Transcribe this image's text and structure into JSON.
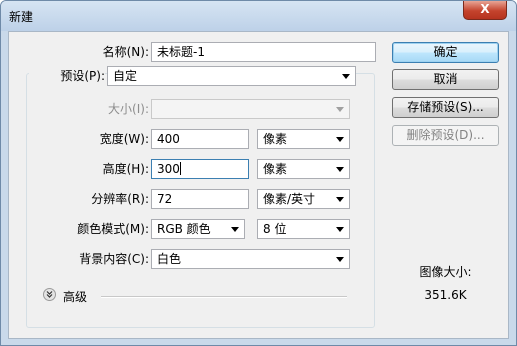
{
  "window": {
    "title": "新建",
    "close_glyph": "X"
  },
  "form": {
    "name": {
      "label": "名称(N):",
      "value": "未标题-1"
    },
    "preset": {
      "label": "预设(P):",
      "value": "自定"
    },
    "size": {
      "label": "大小(I):",
      "value": ""
    },
    "width": {
      "label": "宽度(W):",
      "value": "400",
      "unit": "像素"
    },
    "height": {
      "label": "高度(H):",
      "value": "300",
      "unit": "像素"
    },
    "resolution": {
      "label": "分辨率(R):",
      "value": "72",
      "unit": "像素/英寸"
    },
    "color_mode": {
      "label": "颜色模式(M):",
      "mode": "RGB 颜色",
      "depth": "8 位"
    },
    "background": {
      "label": "背景内容(C):",
      "value": "白色"
    },
    "advanced": {
      "label": "高级",
      "icon": "double-chevron-down-icon"
    }
  },
  "buttons": {
    "ok": "确定",
    "cancel": "取消",
    "save_preset": "存储预设(S)...",
    "delete_preset": "删除预设(D)..."
  },
  "image_size": {
    "label": "图像大小:",
    "value": "351.6K"
  }
}
